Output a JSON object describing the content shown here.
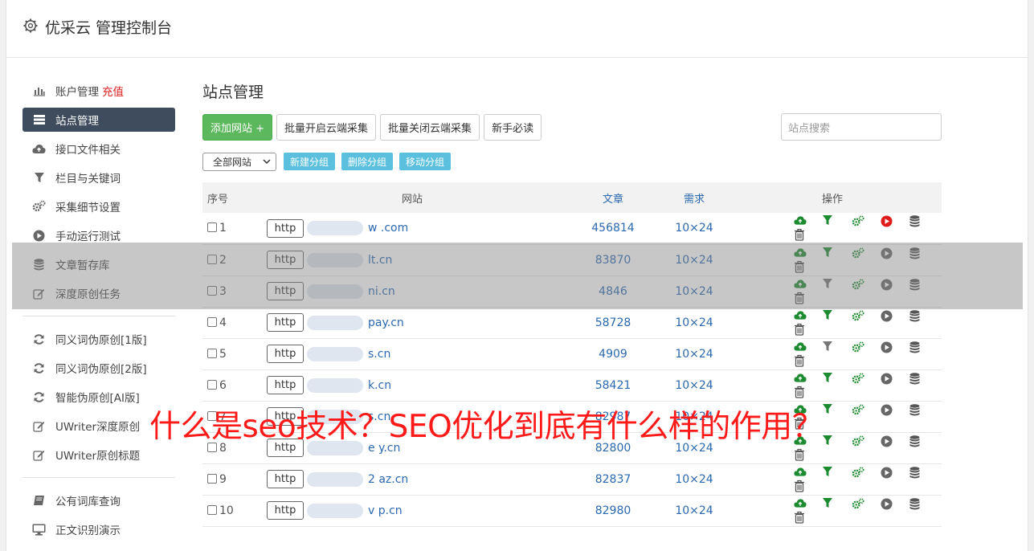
{
  "header": {
    "title": "优采云 管理控制台"
  },
  "sidebar": {
    "group1": [
      {
        "label": "账户管理",
        "icon": "bar-chart-icon",
        "extra": "充值"
      },
      {
        "label": "站点管理",
        "icon": "server-list-icon",
        "active": true
      },
      {
        "label": "接口文件相关",
        "icon": "cloud-upload-icon"
      },
      {
        "label": "栏目与关键词",
        "icon": "filter-icon"
      },
      {
        "label": "采集细节设置",
        "icon": "gears-icon"
      },
      {
        "label": "手动运行测试",
        "icon": "play-icon"
      },
      {
        "label": "文章暂存库",
        "icon": "database-icon"
      },
      {
        "label": "深度原创任务",
        "icon": "edit-icon"
      }
    ],
    "group2": [
      {
        "label": "同义词伪原创[1版]",
        "icon": "refresh-icon"
      },
      {
        "label": "同义词伪原创[2版]",
        "icon": "refresh-icon"
      },
      {
        "label": "智能伪原创[AI版]",
        "icon": "refresh-icon"
      },
      {
        "label": "UWriter深度原创",
        "icon": "edit-icon"
      },
      {
        "label": "UWriter原创标题",
        "icon": "edit-icon"
      }
    ],
    "group3": [
      {
        "label": "公有词库查询",
        "icon": "book-icon"
      },
      {
        "label": "正文识别演示",
        "icon": "monitor-icon"
      }
    ]
  },
  "main": {
    "title": "站点管理",
    "buttons": {
      "add": "添加网站 +",
      "batch_on": "批量开启云端采集",
      "batch_off": "批量关闭云端采集",
      "guide": "新手必读"
    },
    "search_placeholder": "站点搜索",
    "group_select": "全部网站",
    "group_buttons": {
      "new": "新建分组",
      "delete": "删除分组",
      "move": "移动分组"
    },
    "table": {
      "headers": {
        "no": "序号",
        "site": "网站",
        "articles": "文章",
        "demand": "需求",
        "ops": "操作"
      },
      "rows": [
        {
          "no": "1",
          "protocol": "http",
          "domain": "w           .com",
          "articles": "456814",
          "demand": "10×24"
        },
        {
          "no": "2",
          "protocol": "http",
          "domain": "lt.cn",
          "articles": "83870",
          "demand": "10×24"
        },
        {
          "no": "3",
          "protocol": "http",
          "domain": "ni.cn",
          "articles": "4846",
          "demand": "10×24"
        },
        {
          "no": "4",
          "protocol": "http",
          "domain": "pay.cn",
          "articles": "58728",
          "demand": "10×24"
        },
        {
          "no": "5",
          "protocol": "http",
          "domain": "s.cn",
          "articles": "4909",
          "demand": "10×24"
        },
        {
          "no": "6",
          "protocol": "http",
          "domain": "k.cn",
          "articles": "58421",
          "demand": "10×24"
        },
        {
          "no": "7",
          "protocol": "http",
          "domain": "s.cn",
          "articles": "82987",
          "demand": "10×24"
        },
        {
          "no": "8",
          "protocol": "http",
          "domain": "e   y.cn",
          "articles": "82800",
          "demand": "10×24"
        },
        {
          "no": "9",
          "protocol": "http",
          "domain": "2   az.cn",
          "articles": "82837",
          "demand": "10×24"
        },
        {
          "no": "10",
          "protocol": "http",
          "domain": "v   p.cn",
          "articles": "82980",
          "demand": "10×24"
        }
      ]
    }
  },
  "overlay_text": "什么是seo技术？SEO优化到底有什么样的作用？",
  "colors": {
    "sidebar_active": "#3f4c5e",
    "green": "#5cb85c",
    "info": "#5bc0de",
    "link": "#2a68b0",
    "red_text": "#ff1a1a"
  }
}
